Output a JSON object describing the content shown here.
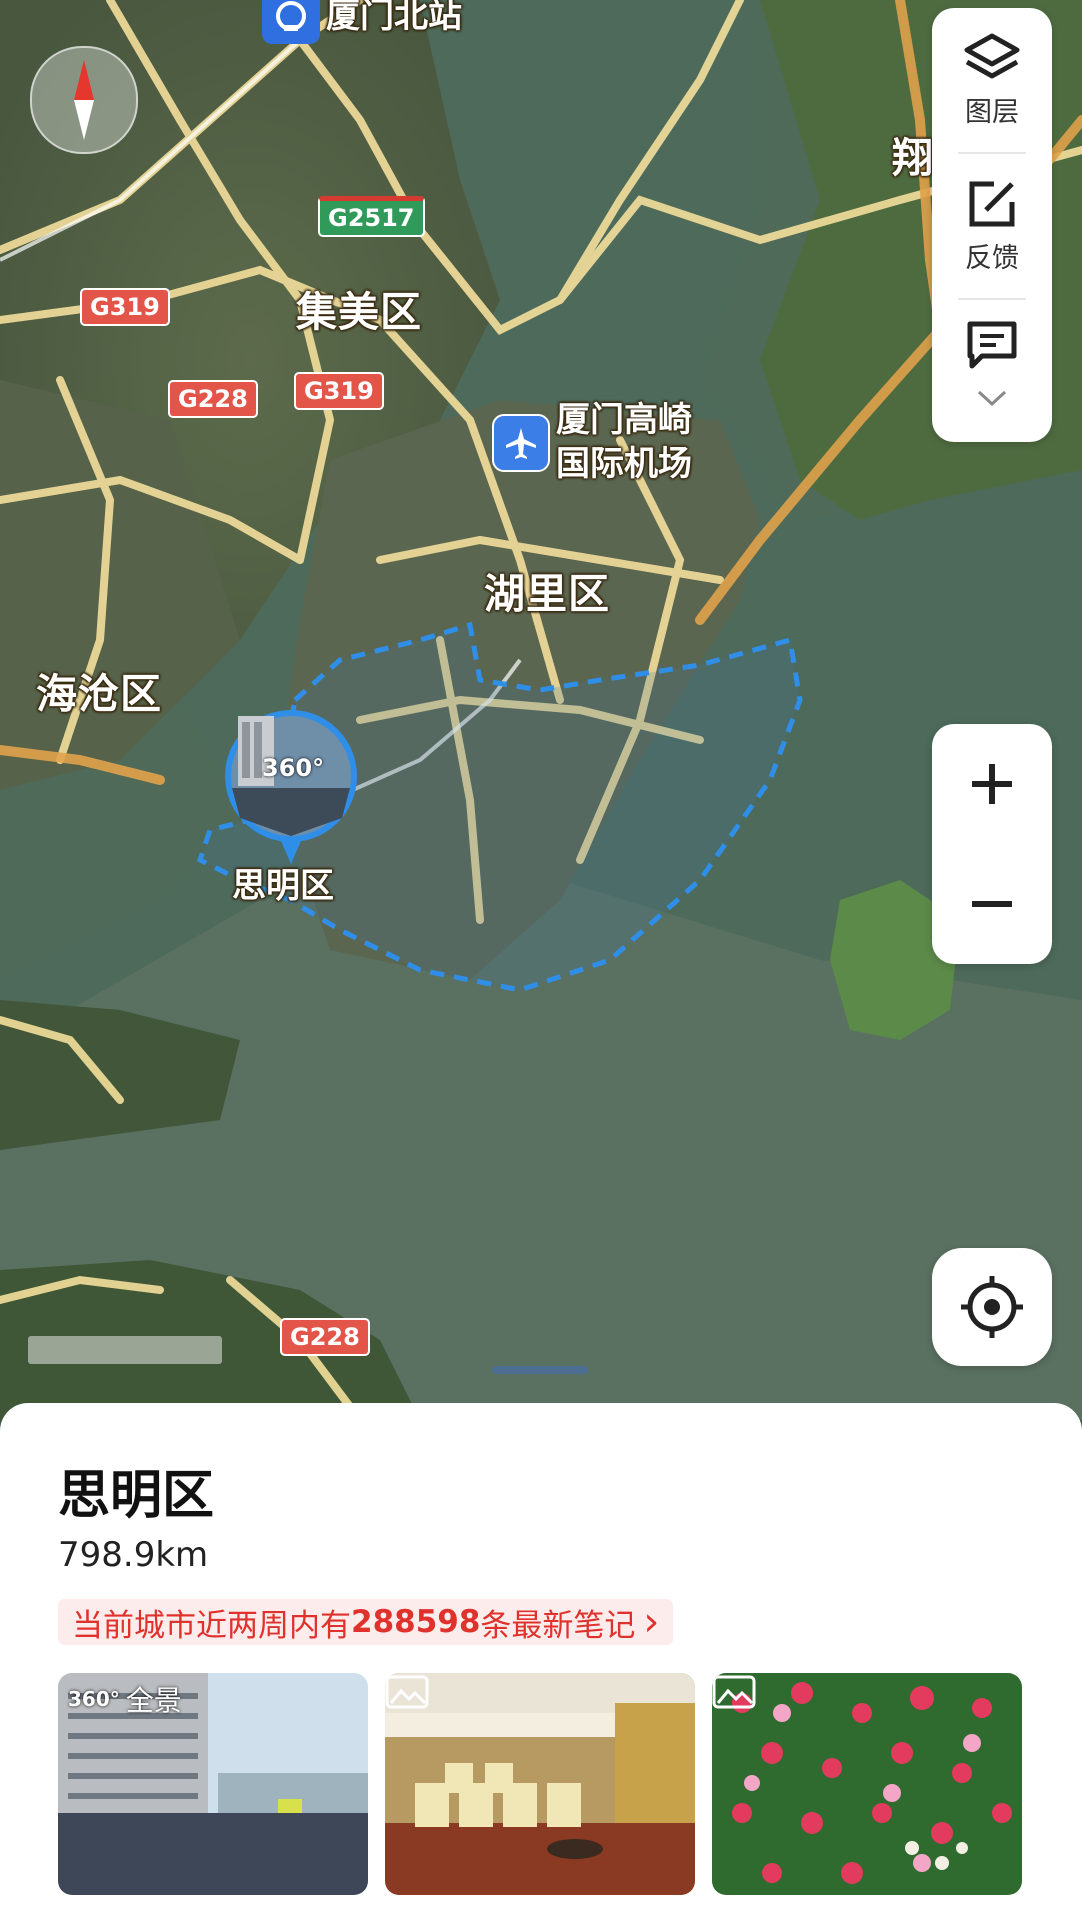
{
  "map": {
    "labels": {
      "xiamen_north_station": "厦门北站",
      "jimei": "集美区",
      "airport_line1": "厦门高崎",
      "airport_line2": "国际机场",
      "huli": "湖里区",
      "haicang": "海沧区",
      "siming": "思明区",
      "xiang_partial": "翔"
    },
    "road_shields": {
      "g2517": "G2517",
      "g319_left": "G319",
      "g228_upper": "G228",
      "g319_center": "G319",
      "g228_lower": "G228"
    },
    "panorama_badge": "360°",
    "boundary_color": "#2f8fe8"
  },
  "toolbar": {
    "layers_label": "图层",
    "feedback_label": "反馈"
  },
  "place": {
    "title": "思明区",
    "distance": "798.9km",
    "notes_prefix": "当前城市近两周内有",
    "notes_count": "288598",
    "notes_suffix": "条最新笔记",
    "notes_chevron": "›"
  },
  "photos": {
    "first_badge_icon": "360°",
    "first_badge_text": "全景"
  },
  "colors": {
    "accent_red": "#e0322d",
    "road_yellow": "#f0dc9a"
  }
}
